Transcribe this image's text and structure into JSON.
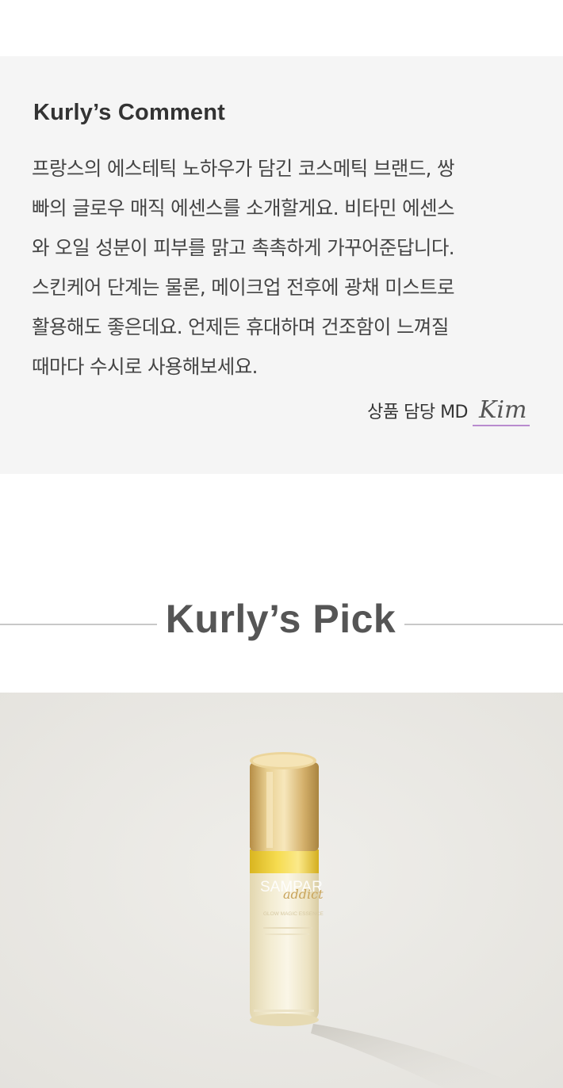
{
  "comment": {
    "title": "Kurly’s Comment",
    "lines": [
      "프랑스의 에스테틱 노하우가 담긴 코스메틱 브랜드, 쌍",
      "빠의 글로우 매직 에센스를 소개할게요. 비타민 에센스",
      "와 오일 성분이 피부를 맑고 촉촉하게 가꾸어준답니다.",
      "스킨케어 단계는 물론, 메이크업 전후에 광채 미스트로",
      "활용해도 좋은데요. 언제든 휴대하며 건조함이 느껴질",
      "때마다 수시로 사용해보세요."
    ],
    "signature_role": "상품 담당 MD",
    "signature_name": "Kim",
    "signature_underline_color": "#b98bcf"
  },
  "pick": {
    "title": "Kurly’s Pick"
  },
  "product": {
    "brand": "SAMPAR",
    "script_text": "addict",
    "product_name": "GLOW MAGIC ESSENCE"
  },
  "colors": {
    "comment_background": "#f5f5f5",
    "divider": "#c8c8c8",
    "cap_gold": "#d9b56a",
    "oil_yellow": "#f2d23c"
  }
}
